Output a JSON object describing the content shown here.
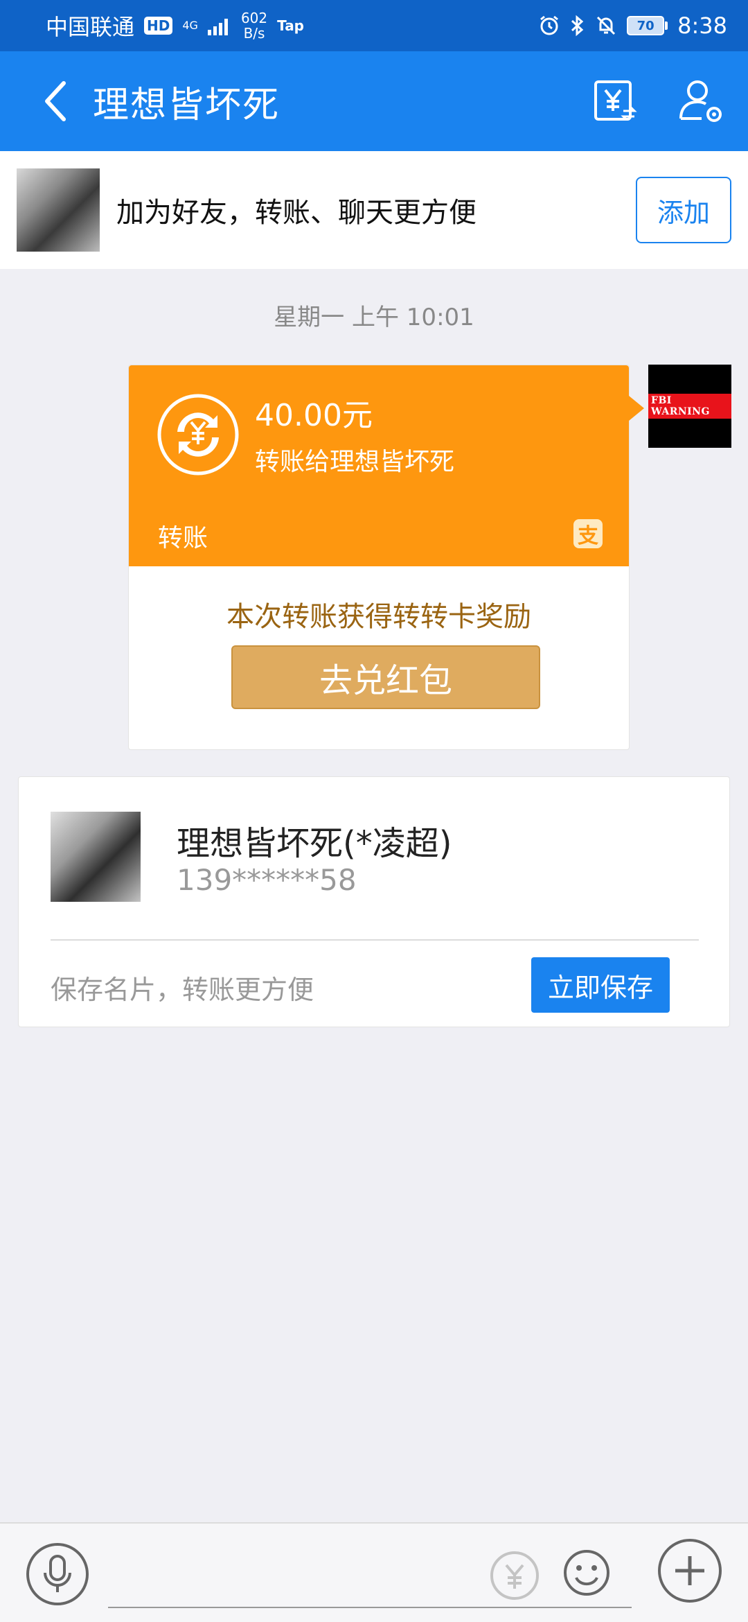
{
  "status_bar": {
    "carrier": "中国联通",
    "hd": "HD",
    "network": "4G",
    "speed_value": "602",
    "speed_unit": "B/s",
    "tap": "Tap",
    "battery": "70",
    "time": "8:38"
  },
  "header": {
    "title": "理想皆坏死",
    "icons": [
      "back-icon",
      "transfer-yen-icon",
      "user-settings-icon"
    ]
  },
  "friend_bar": {
    "text": "加为好友，转账、聊天更方便",
    "add_label": "添加"
  },
  "chat": {
    "timestamp": "星期一 上午 10:01",
    "transfer": {
      "amount": "40.00元",
      "description": "转账给理想皆坏死",
      "type_label": "转账",
      "reward_text": "本次转账获得转转卡奖励",
      "reward_button": "去兑红包"
    },
    "sender_avatar_text": "FBI WARNING"
  },
  "contact_card": {
    "name": "理想皆坏死(*凌超)",
    "phone": "139******58",
    "hint": "保存名片，转账更方便",
    "save_label": "立即保存"
  },
  "colors": {
    "status_bar": "#0f63c7",
    "header": "#1a83ef",
    "transfer": "#fe970f",
    "reward_button": "#dfab5f"
  }
}
